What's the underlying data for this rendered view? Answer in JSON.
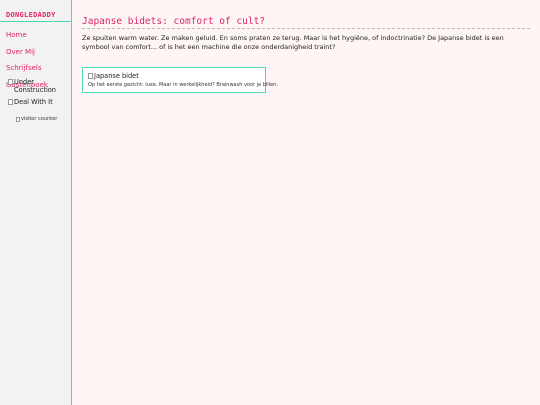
{
  "site": {
    "title": "DONGLEDADDY"
  },
  "nav": [
    {
      "label": "Home"
    },
    {
      "label": "Over Mij"
    },
    {
      "label": "Schrijfsels"
    },
    {
      "label": "Gastenboek"
    }
  ],
  "sidebar_badges": {
    "under_construction_alt": "Under Construction",
    "deal_with_it_alt": "Deal With It",
    "visitor_counter_alt": "visitor counter"
  },
  "article": {
    "title": "Japanse bidets: comfort of cult?",
    "intro": "Ze spuiten warm water. Ze maken geluid. En soms praten ze terug. Maar is het hygiëne, of indoctrinatie? De Japanse bidet is een symbool van comfort... of is het een machine die onze onderdanigheid traint?",
    "figure": {
      "image_alt": "Japanse bidet",
      "caption": "Op het eerste gezicht: luxe. Maar in werkelijkheid? Brainwash voor je billen."
    }
  },
  "colors": {
    "accent": "#e0246a",
    "border": "#4fd6b5",
    "background": "#fdf6f4",
    "sidebar": "#f2f2f2"
  }
}
